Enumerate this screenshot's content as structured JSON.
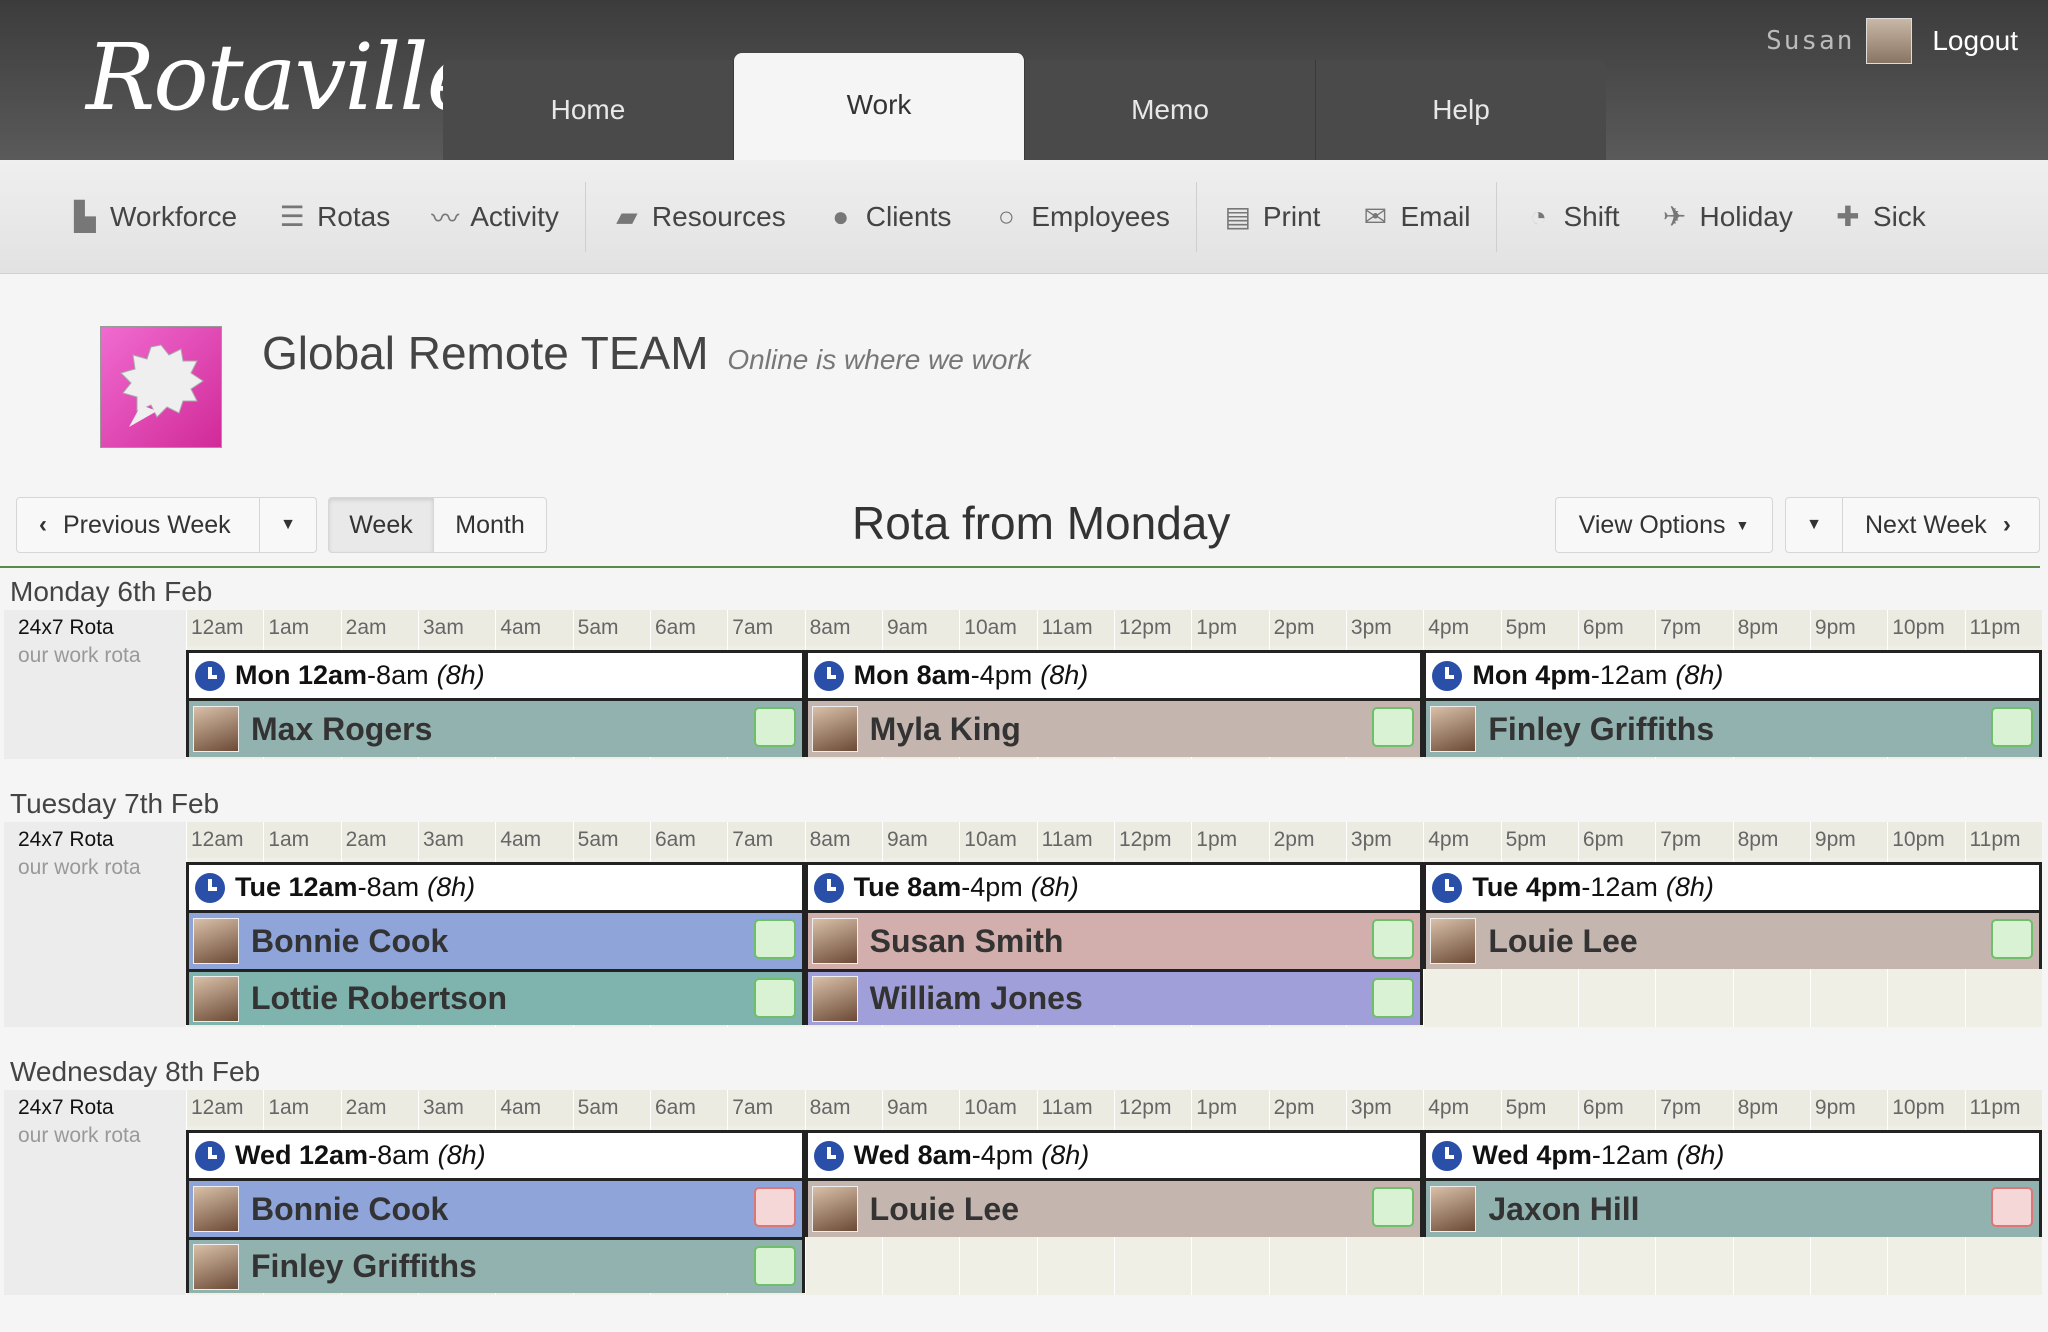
{
  "app": {
    "logo": "Rotaville",
    "user": "Susan",
    "logout": "Logout"
  },
  "tabs": [
    "Home",
    "Work",
    "Memo",
    "Help"
  ],
  "active_tab": "Work",
  "toolbar": {
    "workforce": "Workforce",
    "rotas": "Rotas",
    "activity": "Activity",
    "resources": "Resources",
    "clients": "Clients",
    "employees": "Employees",
    "print": "Print",
    "email": "Email",
    "shift": "Shift",
    "holiday": "Holiday",
    "sick": "Sick"
  },
  "team": {
    "name": "Global Remote TEAM",
    "tagline": "Online is where we work"
  },
  "nav": {
    "prev": "Previous Week",
    "week": "Week",
    "month": "Month",
    "title": "Rota from Monday",
    "view_options": "View Options",
    "next": "Next Week"
  },
  "hours": [
    "12am",
    "1am",
    "2am",
    "3am",
    "4am",
    "5am",
    "6am",
    "7am",
    "8am",
    "9am",
    "10am",
    "11am",
    "12pm",
    "1pm",
    "2pm",
    "3pm",
    "4pm",
    "5pm",
    "6pm",
    "7pm",
    "8pm",
    "9pm",
    "10pm",
    "11pm"
  ],
  "rota": {
    "name": "24x7 Rota",
    "sub": "our work rota"
  },
  "days": [
    {
      "title": "Monday 6th Feb",
      "shifts": [
        {
          "start": "Mon 12am",
          "end": "8am",
          "dur": "(8h)",
          "employees": [
            {
              "name": "Max Rogers",
              "color": "#92b2b0",
              "status": "ok"
            }
          ]
        },
        {
          "start": "Mon 8am",
          "end": "4pm",
          "dur": "(8h)",
          "employees": [
            {
              "name": "Myla King",
              "color": "#c4b5af",
              "status": "ok"
            }
          ]
        },
        {
          "start": "Mon 4pm",
          "end": "12am",
          "dur": "(8h)",
          "employees": [
            {
              "name": "Finley Griffiths",
              "color": "#92b2b0",
              "status": "ok"
            }
          ]
        }
      ]
    },
    {
      "title": "Tuesday 7th Feb",
      "shifts": [
        {
          "start": "Tue 12am",
          "end": "8am",
          "dur": "(8h)",
          "employees": [
            {
              "name": "Bonnie Cook",
              "color": "#8fa4d8",
              "status": "ok"
            },
            {
              "name": "Lottie Robertson",
              "color": "#7fb3ae",
              "status": "ok"
            }
          ]
        },
        {
          "start": "Tue 8am",
          "end": "4pm",
          "dur": "(8h)",
          "employees": [
            {
              "name": "Susan Smith",
              "color": "#d2aeac",
              "status": "ok"
            },
            {
              "name": "William Jones",
              "color": "#a19fd9",
              "status": "ok"
            }
          ]
        },
        {
          "start": "Tue 4pm",
          "end": "12am",
          "dur": "(8h)",
          "employees": [
            {
              "name": "Louie Lee",
              "color": "#c4b5af",
              "status": "ok"
            }
          ]
        }
      ]
    },
    {
      "title": "Wednesday 8th Feb",
      "shifts": [
        {
          "start": "Wed 12am",
          "end": "8am",
          "dur": "(8h)",
          "employees": [
            {
              "name": "Bonnie Cook",
              "color": "#8fa4d8",
              "status": "alert"
            },
            {
              "name": "Finley Griffiths",
              "color": "#92b2b0",
              "status": "ok"
            }
          ]
        },
        {
          "start": "Wed 8am",
          "end": "4pm",
          "dur": "(8h)",
          "employees": [
            {
              "name": "Louie Lee",
              "color": "#c4b5af",
              "status": "ok"
            }
          ]
        },
        {
          "start": "Wed 4pm",
          "end": "12am",
          "dur": "(8h)",
          "employees": [
            {
              "name": "Jaxon Hill",
              "color": "#92b2b0",
              "status": "alert"
            }
          ]
        }
      ]
    }
  ]
}
